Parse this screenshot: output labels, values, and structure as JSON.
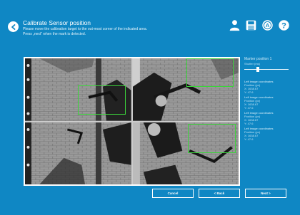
{
  "header": {
    "title": "Calibrate Sensor position",
    "instructions": [
      "Please move the calibration target to the out-most corner of the indicated area.",
      "Press „next“ when the mark is detected."
    ]
  },
  "toolbar": {
    "icons": [
      "user-icon",
      "save-icon",
      "autofocus-icon",
      "help-icon"
    ],
    "autofocus_letter": "A",
    "help_letter": "?"
  },
  "side_panel": {
    "marker_label": "Marker position 1",
    "shutter_label": "Shutter (ms)",
    "shutter_level": 0.3,
    "coordinate_groups": [
      {
        "label": "Left image coordinates",
        "position": "Position (px)",
        "x": "X: 1638.67",
        "y": "Y: 47.6"
      },
      {
        "label": "Left image coordinates",
        "position": "Position (px)",
        "x": "X: 1638.67",
        "y": "Y: 47.6"
      },
      {
        "label": "Left image coordinates",
        "position": "Position (px)",
        "x": "X: 1638.67",
        "y": "Y: 47.6"
      },
      {
        "label": "Left image coordinates",
        "position": "Position (px)",
        "x": "X: 1638.67",
        "y": "Y: 47.6"
      }
    ]
  },
  "buttons": {
    "cancel": "Cancel",
    "back": "< Back",
    "next": "Next >"
  },
  "colors": {
    "background": "#0f87c4",
    "marker": "#3bd43b"
  }
}
